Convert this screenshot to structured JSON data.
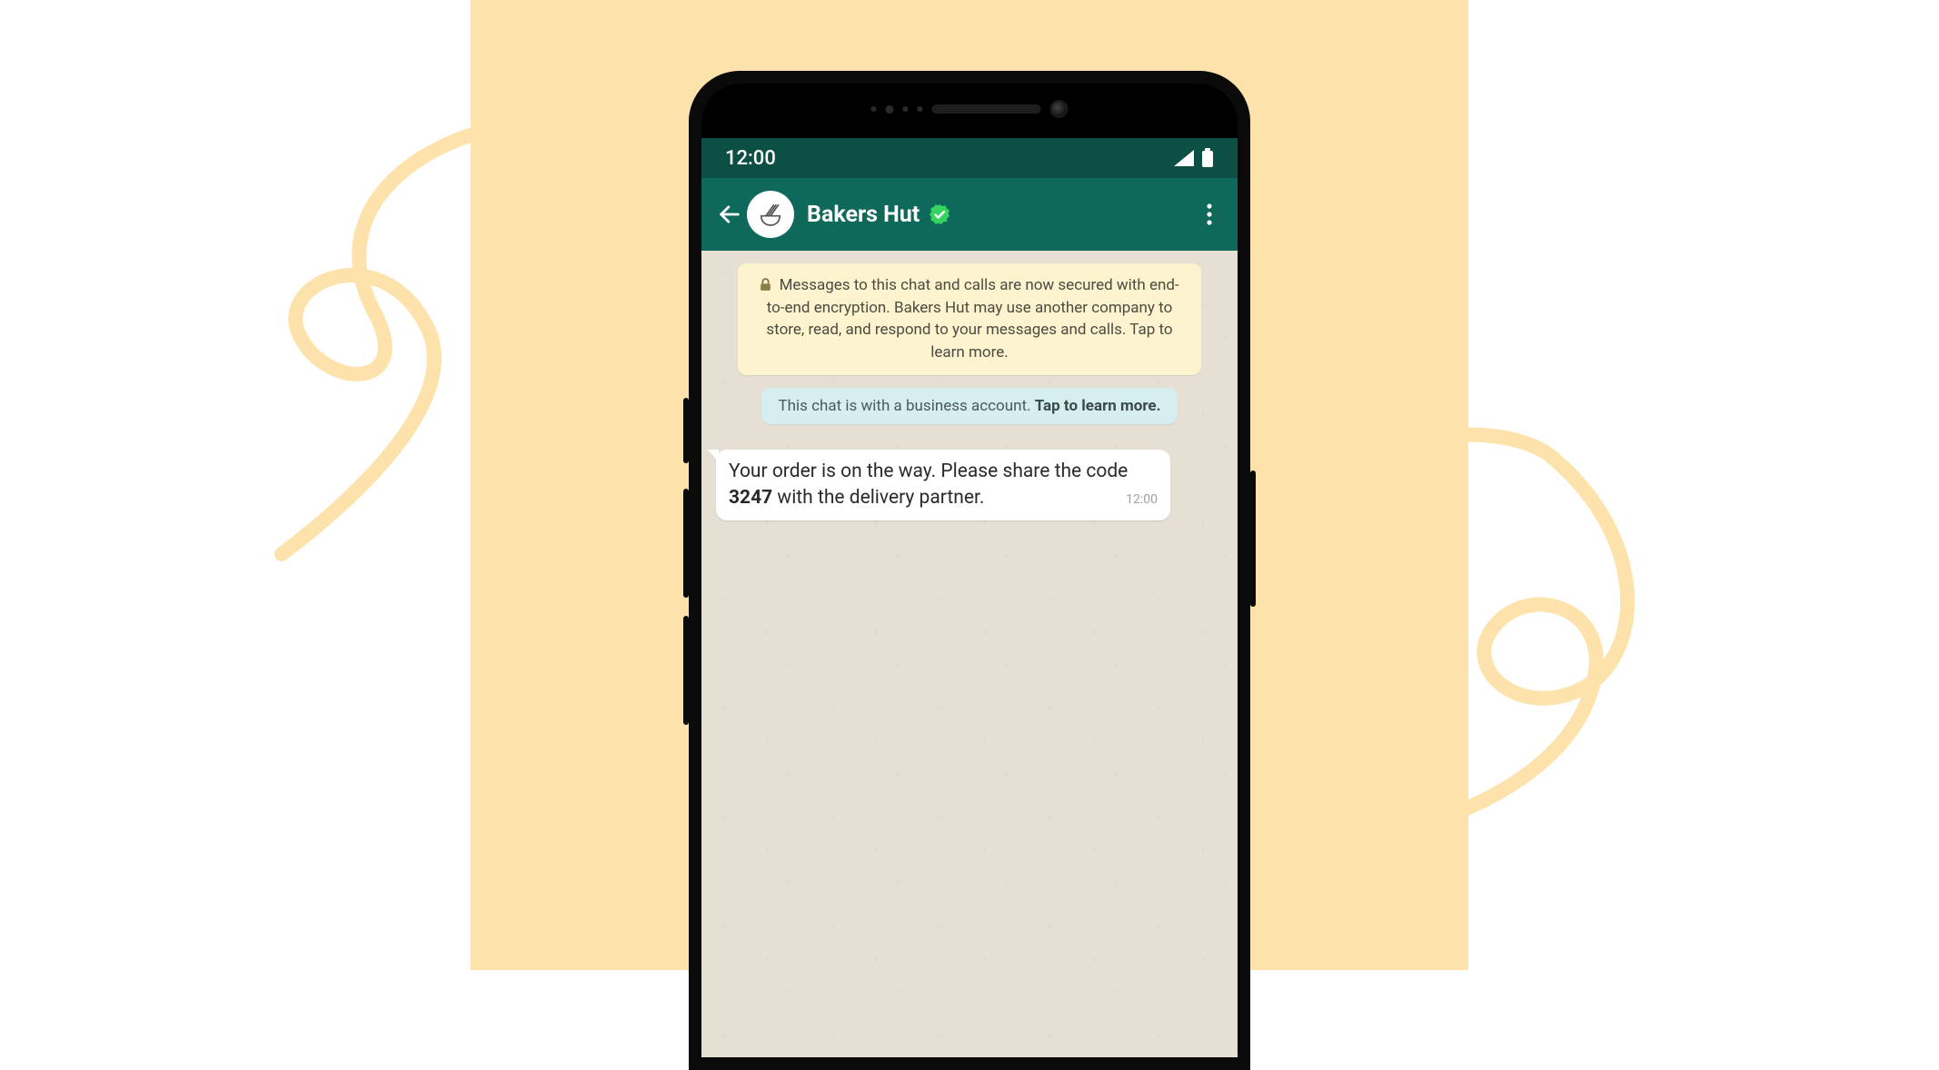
{
  "statusBar": {
    "time": "12:00"
  },
  "header": {
    "contactName": "Bakers Hut"
  },
  "notices": {
    "encryption": "Messages to this chat and calls are now secured with end-to-end encryption. Bakers Hut may use another company to store, read, and respond to your messages and calls. Tap to learn more.",
    "businessPrefix": "This chat is with a business account. ",
    "businessLink": "Tap to learn more."
  },
  "message": {
    "textBefore": "Your order is on the way. Please share the code ",
    "code": "3247",
    "textAfter": " with the delivery partner.",
    "time": "12:00"
  },
  "colors": {
    "beige": "#fde3ab",
    "headerDark": "#0c4f44",
    "headerGreen": "#0f695b",
    "noticeYellow": "#fdf4cf",
    "noticeBlue": "#d6eef0",
    "chatBg": "#e6e0d4"
  }
}
